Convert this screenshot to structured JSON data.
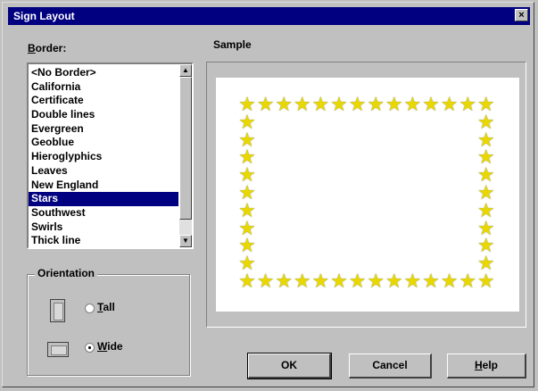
{
  "window": {
    "title": "Sign Layout",
    "close_glyph": "×"
  },
  "border_section": {
    "label_accel": "B",
    "label_rest": "order:",
    "items": [
      "<No Border>",
      "California",
      "Certificate",
      "Double lines",
      "Evergreen",
      "Geoblue",
      "Hieroglyphics",
      "Leaves",
      "New England",
      "Stars",
      "Southwest",
      "Swirls",
      "Thick line"
    ],
    "selected": "Stars",
    "scroll_up_glyph": "▲",
    "scroll_down_glyph": "▼"
  },
  "orientation": {
    "title": "Orientation",
    "tall_accel": "T",
    "tall_rest": "all",
    "wide_accel": "W",
    "wide_rest": "ide",
    "selected": "Wide"
  },
  "sample": {
    "title": "Sample",
    "border_glyph": "★",
    "border_color": "#e8d800"
  },
  "buttons": {
    "ok": "OK",
    "cancel": "Cancel",
    "help_accel": "H",
    "help_rest": "elp"
  }
}
